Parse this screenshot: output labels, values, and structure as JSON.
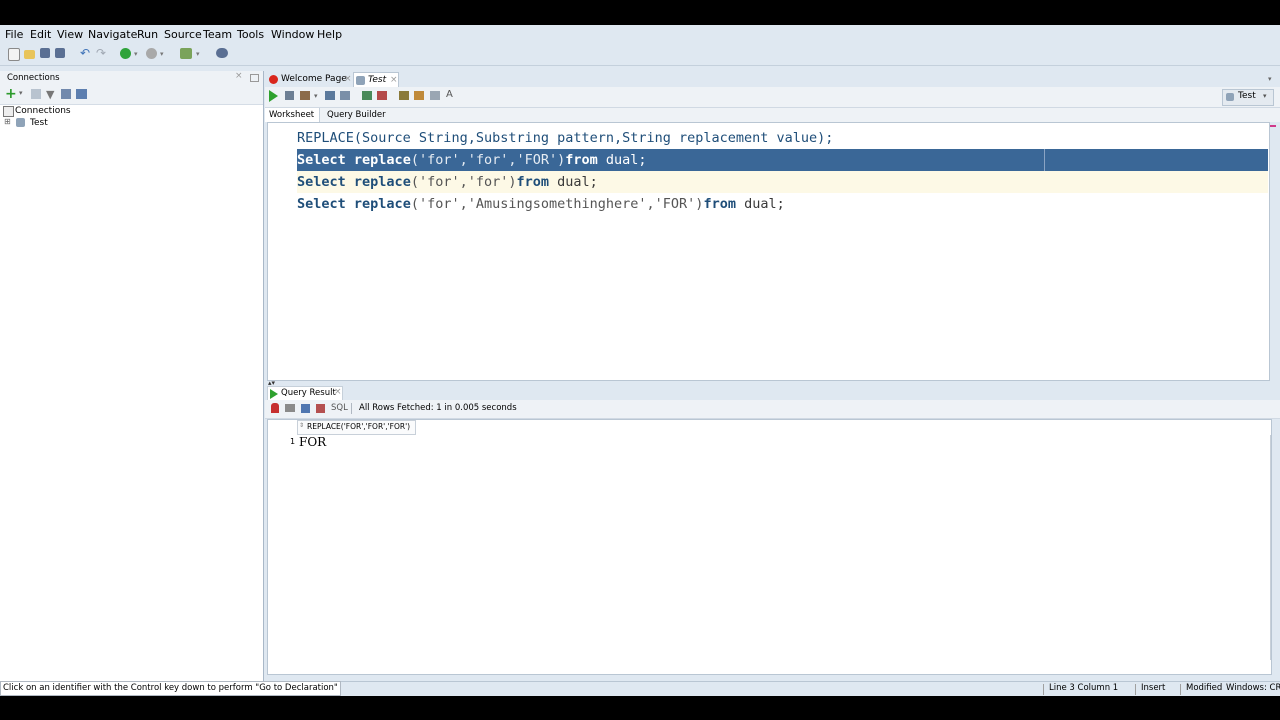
{
  "menu": [
    "File",
    "Edit",
    "View",
    "Navigate",
    "Run",
    "Source",
    "Team",
    "Tools",
    "Window",
    "Help"
  ],
  "connections_panel": {
    "title": "Connections",
    "tree": [
      {
        "label": "Connections"
      },
      {
        "label": "Test"
      }
    ]
  },
  "editor_tabs": [
    {
      "label": "Welcome Page"
    },
    {
      "label": "Test"
    }
  ],
  "connection_selector": "Test",
  "subtabs": [
    "Worksheet",
    "Query Builder"
  ],
  "code": {
    "line1": {
      "fn": "REPLACE",
      "rest": "(Source String,Substring pattern,String replacement value);"
    },
    "line2": {
      "a": "Select",
      "b": "replace",
      "c": "('for','for','FOR')",
      "d": "from",
      "e": "dual;"
    },
    "line3": {
      "a": "Select",
      "b": "replace",
      "c": "('for','for')",
      "d": "from",
      "e": "dual;"
    },
    "line4": {
      "a": "Select",
      "b": "replace",
      "c": "('for','Amusingsomethinghere','FOR')",
      "d": "from",
      "e": "dual;"
    }
  },
  "result": {
    "tab_label": "Query Result",
    "sql_label": "SQL",
    "fetch_status": "All Rows Fetched: 1 in 0.005 seconds",
    "column_header": "REPLACE('FOR','FOR','FOR')",
    "rows": [
      {
        "num": "1",
        "value": "FOR"
      }
    ]
  },
  "status": {
    "hint": "Click on an identifier with the Control key down to perform \"Go to Declaration\"",
    "position": "Line 3 Column 1",
    "mode": "Insert",
    "modified": "Modified",
    "line_end": "Windows: CR"
  },
  "colors": {
    "selection": "#3a6797",
    "current_line": "#fdf9e6",
    "keyword": "#1f4e79"
  }
}
